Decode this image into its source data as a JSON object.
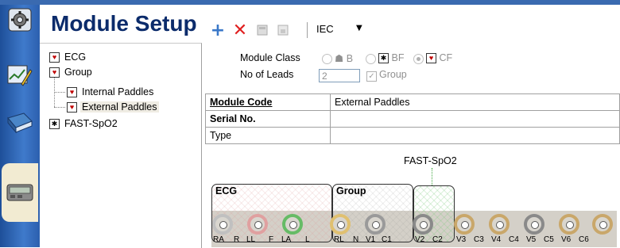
{
  "header": {
    "title": "Module Setup",
    "standard": "IEC"
  },
  "tree": {
    "items": [
      {
        "label": "ECG",
        "icon": "cf-heart-icon"
      },
      {
        "label": "Group",
        "icon": "cf-heart-icon"
      },
      {
        "label": "Internal Paddles",
        "icon": "cf-heart-icon"
      },
      {
        "label": "External Paddles",
        "icon": "cf-heart-icon",
        "selected": true
      },
      {
        "label": "FAST-SpO2",
        "icon": "bf-icon"
      }
    ]
  },
  "form": {
    "module_class_label": "Module Class",
    "leads_label": "No of Leads",
    "leads_value": "2",
    "class_options": [
      {
        "label": "B",
        "selected": false
      },
      {
        "label": "BF",
        "selected": false
      },
      {
        "label": "CF",
        "selected": true
      }
    ],
    "group_label": "Group",
    "group_checked": true
  },
  "properties": [
    {
      "key": "Module Code",
      "value": "External Paddles"
    },
    {
      "key": "Serial No.",
      "value": ""
    },
    {
      "key": "Type",
      "value": ""
    }
  ],
  "diagram": {
    "top_label": "FAST-SpO2",
    "groups": [
      "ECG",
      "Group"
    ],
    "electrode_labels": [
      "RA",
      "R",
      "LL",
      "F",
      "LA",
      "L",
      "RL",
      "N",
      "V1",
      "C1",
      "V2",
      "C2",
      "V3",
      "C3",
      "V4",
      "C4",
      "V5",
      "C5",
      "V6",
      "C6"
    ],
    "electrode_colors": [
      "#c0c0c0",
      "#e0a0a0",
      "#66bb66",
      "#e0c070",
      "#9a9a9a",
      "#8a8a8a",
      "#c9a76a",
      "#c9a76a",
      "#8a8a8a",
      "#c9a76a",
      "#c9a76a"
    ]
  }
}
